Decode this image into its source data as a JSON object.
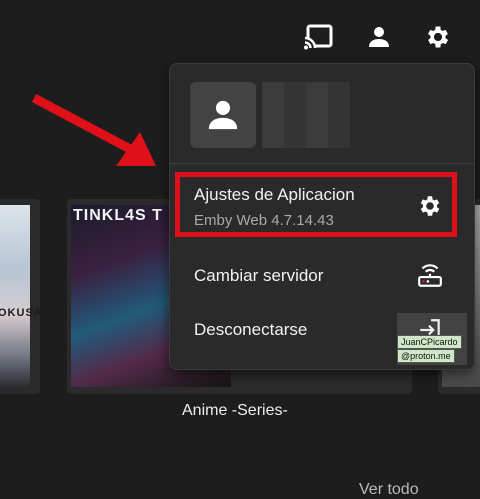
{
  "topbar": {
    "icons": [
      "cast-icon",
      "user-icon",
      "gear-icon"
    ]
  },
  "background": {
    "left_card_text": "OKUSA",
    "main_card_title": "TINKL4S T",
    "main_card_label": "Anime -Series-",
    "see_all": "Ver todo"
  },
  "menu": {
    "avatar_icon": "user-icon",
    "items": [
      {
        "title": "Ajustes de Aplicacion",
        "subtitle": "Emby Web 4.7.14.43",
        "icon": "gear-icon"
      },
      {
        "title": "Cambiar servidor",
        "icon": "router-icon"
      },
      {
        "title": "Desconectarse",
        "icon": "logout-icon"
      }
    ]
  },
  "annotation": {
    "arrow_color": "#e0101a",
    "highlight_color": "#e0101a"
  },
  "watermark": {
    "line1": "JuanCPicardo",
    "line2": "@proton.me"
  }
}
